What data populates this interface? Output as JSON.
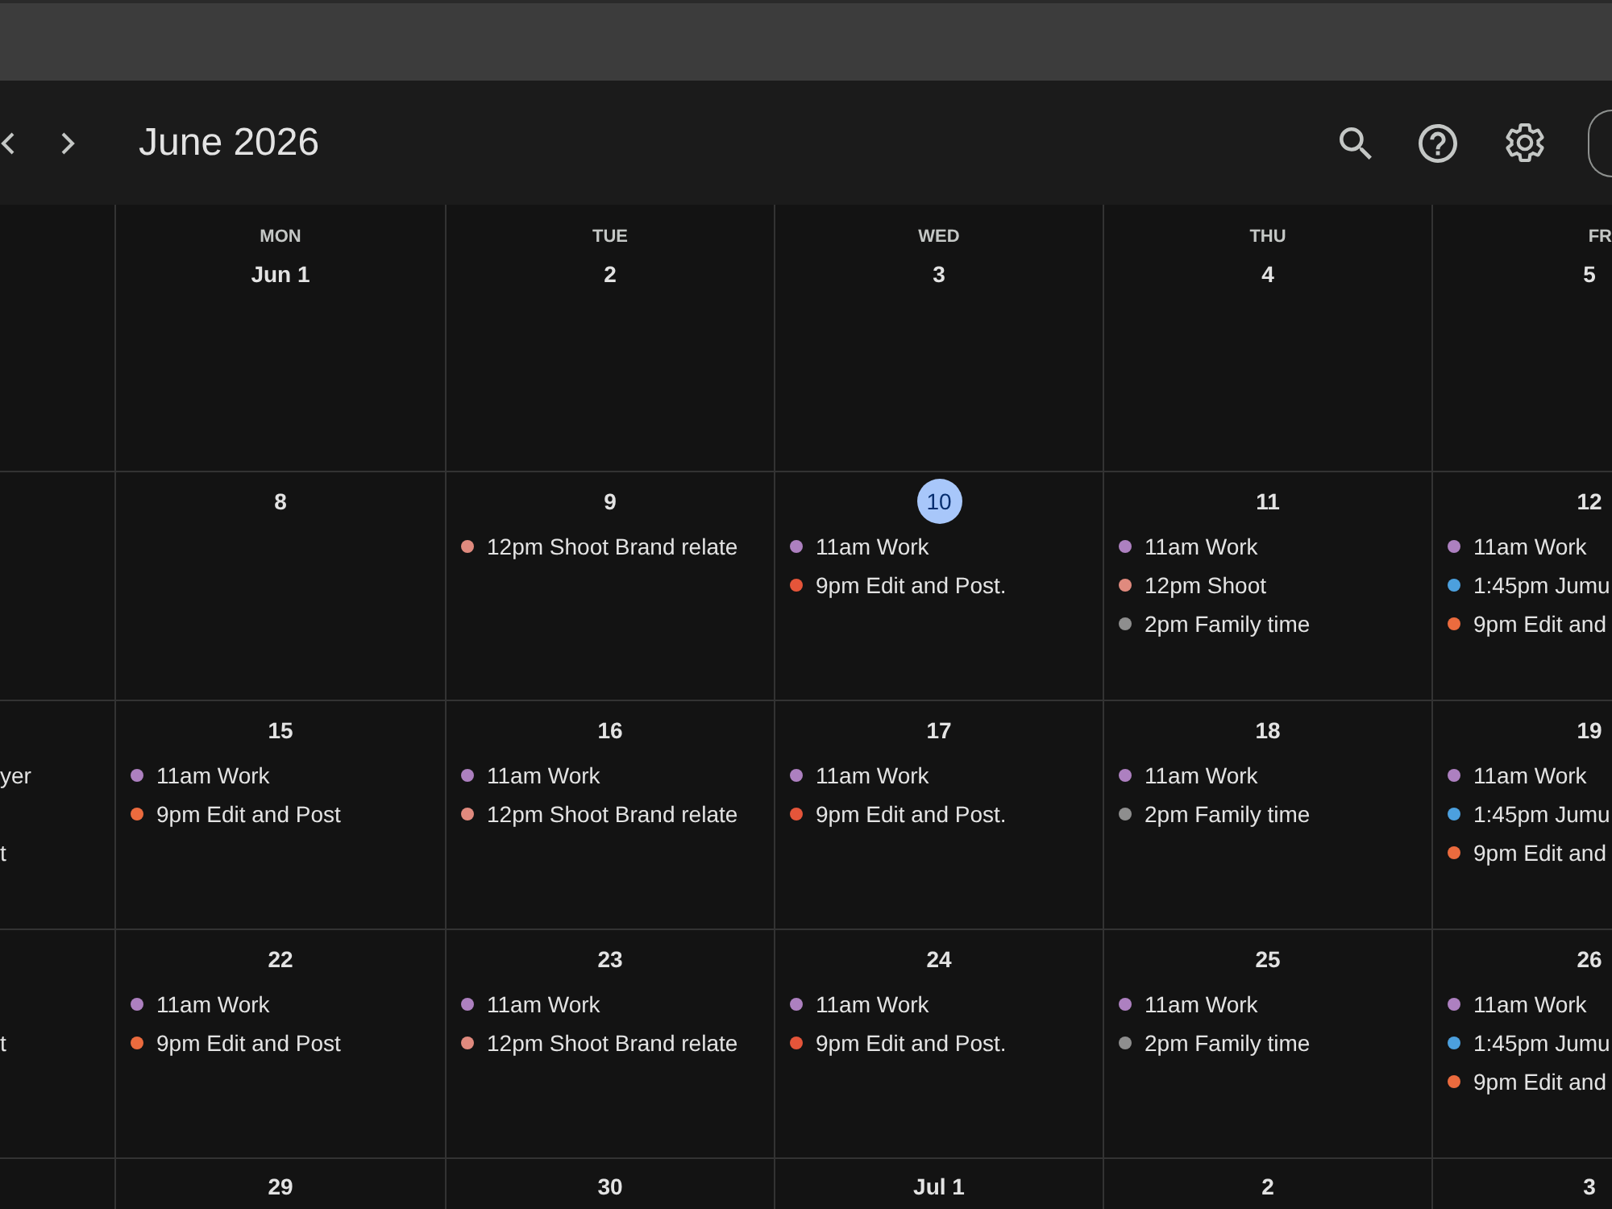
{
  "header": {
    "title": "June 2026"
  },
  "calendar": {
    "weekdays": [
      {
        "label": "MON"
      },
      {
        "label": "TUE"
      },
      {
        "label": "WED"
      },
      {
        "label": "THU"
      },
      {
        "label": "FR"
      }
    ],
    "weeks": [
      {
        "days": [
          {
            "date": "Jun 1",
            "today": false
          },
          {
            "date": "2",
            "today": false
          },
          {
            "date": "3",
            "today": false
          },
          {
            "date": "4",
            "today": false
          },
          {
            "date": "5",
            "today": false
          }
        ]
      },
      {
        "days": [
          {
            "date": "8",
            "today": false
          },
          {
            "date": "9",
            "today": false,
            "events": [
              {
                "text": "12pm Shoot Brand relate",
                "color": "#e08a7e"
              }
            ]
          },
          {
            "date": "10",
            "today": true,
            "events": [
              {
                "text": "11am Work",
                "color": "#ad80c0"
              },
              {
                "text": "9pm Edit and Post.",
                "color": "#e5553a"
              }
            ]
          },
          {
            "date": "11",
            "today": false,
            "events": [
              {
                "text": "11am Work",
                "color": "#ad80c0"
              },
              {
                "text": "12pm Shoot",
                "color": "#e08a7e"
              },
              {
                "text": "2pm Family time",
                "color": "#8e8e8e"
              }
            ]
          },
          {
            "date": "12",
            "today": false,
            "events": [
              {
                "text": "11am Work",
                "color": "#ad80c0"
              },
              {
                "text": "1:45pm Jumu",
                "color": "#4ca0de"
              },
              {
                "text": "9pm Edit and",
                "color": "#eb6b3e"
              }
            ]
          }
        ]
      },
      {
        "sunday": [
          {
            "kind": "fragment",
            "text": "yer"
          },
          {
            "kind": "offscreen"
          },
          {
            "kind": "fragment",
            "text": "t"
          }
        ],
        "days": [
          {
            "date": "15",
            "today": false,
            "events": [
              {
                "text": "11am Work",
                "color": "#ad80c0"
              },
              {
                "text": "9pm Edit and Post",
                "color": "#eb6b3e"
              }
            ]
          },
          {
            "date": "16",
            "today": false,
            "events": [
              {
                "text": "11am Work",
                "color": "#ad80c0"
              },
              {
                "text": "12pm Shoot Brand relate",
                "color": "#e08a7e"
              }
            ]
          },
          {
            "date": "17",
            "today": false,
            "events": [
              {
                "text": "11am Work",
                "color": "#ad80c0"
              },
              {
                "text": "9pm Edit and Post.",
                "color": "#e5553a"
              }
            ]
          },
          {
            "date": "18",
            "today": false,
            "events": [
              {
                "text": "11am Work",
                "color": "#ad80c0"
              },
              {
                "text": "2pm Family time",
                "color": "#8e8e8e"
              }
            ]
          },
          {
            "date": "19",
            "today": false,
            "events": [
              {
                "text": "11am Work",
                "color": "#ad80c0"
              },
              {
                "text": "1:45pm Jumu",
                "color": "#4ca0de"
              },
              {
                "text": "9pm Edit and",
                "color": "#eb6b3e"
              }
            ]
          }
        ]
      },
      {
        "sunday": [
          {
            "kind": "offscreen"
          },
          {
            "kind": "fragment",
            "text": "t"
          }
        ],
        "days": [
          {
            "date": "22",
            "today": false,
            "events": [
              {
                "text": "11am Work",
                "color": "#ad80c0"
              },
              {
                "text": "9pm Edit and Post",
                "color": "#eb6b3e"
              }
            ]
          },
          {
            "date": "23",
            "today": false,
            "events": [
              {
                "text": "11am Work",
                "color": "#ad80c0"
              },
              {
                "text": "12pm Shoot Brand relate",
                "color": "#e08a7e"
              }
            ]
          },
          {
            "date": "24",
            "today": false,
            "events": [
              {
                "text": "11am Work",
                "color": "#ad80c0"
              },
              {
                "text": "9pm Edit and Post.",
                "color": "#e5553a"
              }
            ]
          },
          {
            "date": "25",
            "today": false,
            "events": [
              {
                "text": "11am Work",
                "color": "#ad80c0"
              },
              {
                "text": "2pm Family time",
                "color": "#8e8e8e"
              }
            ]
          },
          {
            "date": "26",
            "today": false,
            "events": [
              {
                "text": "11am Work",
                "color": "#ad80c0"
              },
              {
                "text": "1:45pm Jumu",
                "color": "#4ca0de"
              },
              {
                "text": "9pm Edit and",
                "color": "#eb6b3e"
              }
            ]
          }
        ]
      },
      {
        "days": [
          {
            "date": "29",
            "today": false
          },
          {
            "date": "30",
            "today": false
          },
          {
            "date": "Jul 1",
            "today": false
          },
          {
            "date": "2",
            "today": false
          },
          {
            "date": "3",
            "today": false
          }
        ]
      }
    ]
  }
}
